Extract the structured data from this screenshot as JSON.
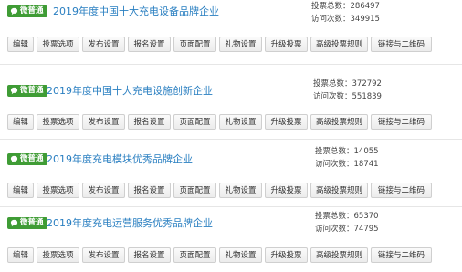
{
  "badge_text": "微普通",
  "badge_icon": "chat-bubble-icon",
  "colors": {
    "badge": "#3f9c35",
    "title": "#2a7fc1"
  },
  "stat_labels": {
    "votes": "投票总数：",
    "visits": "访问次数："
  },
  "buttons": {
    "edit": "编辑",
    "vote_options": "投票选项",
    "publish_settings": "发布设置",
    "signup_settings": "报名设置",
    "page_config": "页面配置",
    "gift_settings": "礼物设置",
    "upgrade_vote": "升级投票",
    "advanced_rules": "高级投票规则",
    "link_qr": "链接与二维码"
  },
  "items": [
    {
      "title": "2019年度中国十大充电设备品牌企业",
      "votes": "286497",
      "visits": "349915"
    },
    {
      "title": "2019年度中国十大充电设施创新企业",
      "votes": "372792",
      "visits": "551839"
    },
    {
      "title": "2019年度充电模块优秀品牌企业",
      "votes": "14055",
      "visits": "18741"
    },
    {
      "title": "2019年度充电运营服务优秀品牌企业",
      "votes": "65370",
      "visits": "74795"
    }
  ]
}
